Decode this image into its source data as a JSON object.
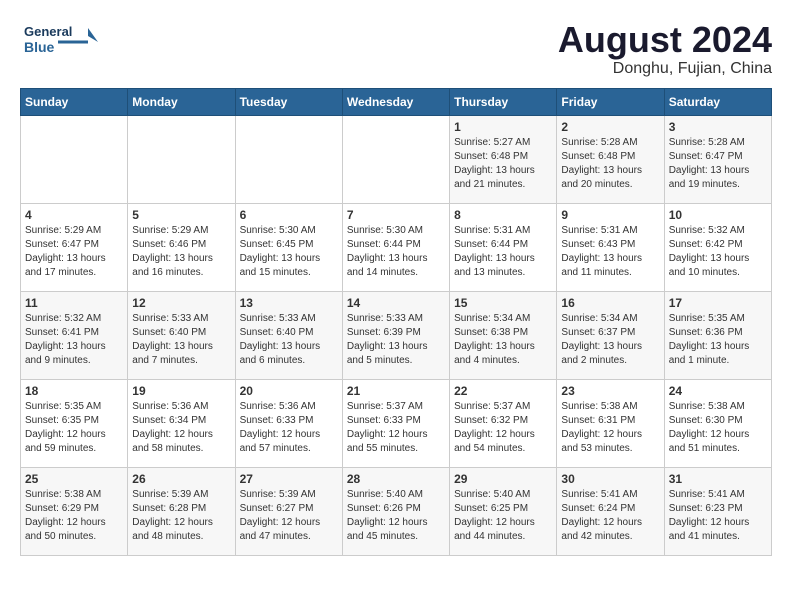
{
  "header": {
    "logo_line1": "General",
    "logo_line2": "Blue",
    "month_year": "August 2024",
    "location": "Donghu, Fujian, China"
  },
  "days_of_week": [
    "Sunday",
    "Monday",
    "Tuesday",
    "Wednesday",
    "Thursday",
    "Friday",
    "Saturday"
  ],
  "weeks": [
    [
      {
        "day": "",
        "info": ""
      },
      {
        "day": "",
        "info": ""
      },
      {
        "day": "",
        "info": ""
      },
      {
        "day": "",
        "info": ""
      },
      {
        "day": "1",
        "info": "Sunrise: 5:27 AM\nSunset: 6:48 PM\nDaylight: 13 hours\nand 21 minutes."
      },
      {
        "day": "2",
        "info": "Sunrise: 5:28 AM\nSunset: 6:48 PM\nDaylight: 13 hours\nand 20 minutes."
      },
      {
        "day": "3",
        "info": "Sunrise: 5:28 AM\nSunset: 6:47 PM\nDaylight: 13 hours\nand 19 minutes."
      }
    ],
    [
      {
        "day": "4",
        "info": "Sunrise: 5:29 AM\nSunset: 6:47 PM\nDaylight: 13 hours\nand 17 minutes."
      },
      {
        "day": "5",
        "info": "Sunrise: 5:29 AM\nSunset: 6:46 PM\nDaylight: 13 hours\nand 16 minutes."
      },
      {
        "day": "6",
        "info": "Sunrise: 5:30 AM\nSunset: 6:45 PM\nDaylight: 13 hours\nand 15 minutes."
      },
      {
        "day": "7",
        "info": "Sunrise: 5:30 AM\nSunset: 6:44 PM\nDaylight: 13 hours\nand 14 minutes."
      },
      {
        "day": "8",
        "info": "Sunrise: 5:31 AM\nSunset: 6:44 PM\nDaylight: 13 hours\nand 13 minutes."
      },
      {
        "day": "9",
        "info": "Sunrise: 5:31 AM\nSunset: 6:43 PM\nDaylight: 13 hours\nand 11 minutes."
      },
      {
        "day": "10",
        "info": "Sunrise: 5:32 AM\nSunset: 6:42 PM\nDaylight: 13 hours\nand 10 minutes."
      }
    ],
    [
      {
        "day": "11",
        "info": "Sunrise: 5:32 AM\nSunset: 6:41 PM\nDaylight: 13 hours\nand 9 minutes."
      },
      {
        "day": "12",
        "info": "Sunrise: 5:33 AM\nSunset: 6:40 PM\nDaylight: 13 hours\nand 7 minutes."
      },
      {
        "day": "13",
        "info": "Sunrise: 5:33 AM\nSunset: 6:40 PM\nDaylight: 13 hours\nand 6 minutes."
      },
      {
        "day": "14",
        "info": "Sunrise: 5:33 AM\nSunset: 6:39 PM\nDaylight: 13 hours\nand 5 minutes."
      },
      {
        "day": "15",
        "info": "Sunrise: 5:34 AM\nSunset: 6:38 PM\nDaylight: 13 hours\nand 4 minutes."
      },
      {
        "day": "16",
        "info": "Sunrise: 5:34 AM\nSunset: 6:37 PM\nDaylight: 13 hours\nand 2 minutes."
      },
      {
        "day": "17",
        "info": "Sunrise: 5:35 AM\nSunset: 6:36 PM\nDaylight: 13 hours\nand 1 minute."
      }
    ],
    [
      {
        "day": "18",
        "info": "Sunrise: 5:35 AM\nSunset: 6:35 PM\nDaylight: 12 hours\nand 59 minutes."
      },
      {
        "day": "19",
        "info": "Sunrise: 5:36 AM\nSunset: 6:34 PM\nDaylight: 12 hours\nand 58 minutes."
      },
      {
        "day": "20",
        "info": "Sunrise: 5:36 AM\nSunset: 6:33 PM\nDaylight: 12 hours\nand 57 minutes."
      },
      {
        "day": "21",
        "info": "Sunrise: 5:37 AM\nSunset: 6:33 PM\nDaylight: 12 hours\nand 55 minutes."
      },
      {
        "day": "22",
        "info": "Sunrise: 5:37 AM\nSunset: 6:32 PM\nDaylight: 12 hours\nand 54 minutes."
      },
      {
        "day": "23",
        "info": "Sunrise: 5:38 AM\nSunset: 6:31 PM\nDaylight: 12 hours\nand 53 minutes."
      },
      {
        "day": "24",
        "info": "Sunrise: 5:38 AM\nSunset: 6:30 PM\nDaylight: 12 hours\nand 51 minutes."
      }
    ],
    [
      {
        "day": "25",
        "info": "Sunrise: 5:38 AM\nSunset: 6:29 PM\nDaylight: 12 hours\nand 50 minutes."
      },
      {
        "day": "26",
        "info": "Sunrise: 5:39 AM\nSunset: 6:28 PM\nDaylight: 12 hours\nand 48 minutes."
      },
      {
        "day": "27",
        "info": "Sunrise: 5:39 AM\nSunset: 6:27 PM\nDaylight: 12 hours\nand 47 minutes."
      },
      {
        "day": "28",
        "info": "Sunrise: 5:40 AM\nSunset: 6:26 PM\nDaylight: 12 hours\nand 45 minutes."
      },
      {
        "day": "29",
        "info": "Sunrise: 5:40 AM\nSunset: 6:25 PM\nDaylight: 12 hours\nand 44 minutes."
      },
      {
        "day": "30",
        "info": "Sunrise: 5:41 AM\nSunset: 6:24 PM\nDaylight: 12 hours\nand 42 minutes."
      },
      {
        "day": "31",
        "info": "Sunrise: 5:41 AM\nSunset: 6:23 PM\nDaylight: 12 hours\nand 41 minutes."
      }
    ]
  ]
}
